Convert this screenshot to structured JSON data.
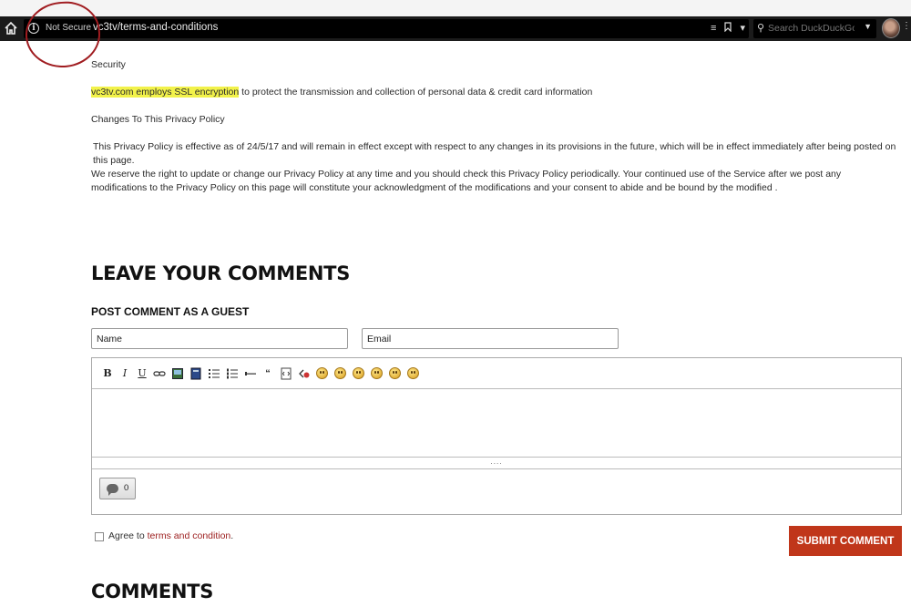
{
  "browser": {
    "security_label": "Not Secure",
    "url": "vc3tv/terms-and-conditions",
    "search_placeholder": "Search DuckDuckGo"
  },
  "content": {
    "security_heading": "Security",
    "ssl_highlight": "vc3tv.com employs SSL encryption",
    "ssl_rest": " to protect the transmission and collection of personal data & credit card information",
    "changes_heading": "Changes To This Privacy Policy",
    "effective_text": "This Privacy Policy is effective as of 24/5/17 and will remain in effect except with respect to any changes in its provisions in the future, which will be in effect immediately after being posted on this page.",
    "reserve_text": "We reserve the right to update or change our Privacy Policy at any time and you should check this Privacy Policy periodically. Your continued use of the Service after we post any modifications to the Privacy Policy on this page will constitute your acknowledgment of the modifications and your consent to abide and be bound by the modified ."
  },
  "comment_form": {
    "section_title": "LEAVE YOUR COMMENTS",
    "guest_heading": "POST COMMENT AS A GUEST",
    "name_placeholder": "Name",
    "email_placeholder": "Email",
    "toolbar": {
      "bold": "B",
      "italic": "I",
      "underline": "U",
      "quote": "“"
    },
    "resize_grip": "....",
    "comment_count": "0",
    "agree_prefix": "Agree to ",
    "terms_link": "terms and condition",
    "agree_suffix": ".",
    "submit_label": "SUBMIT COMMENT"
  },
  "comments": {
    "section_title": "COMMENTS"
  }
}
